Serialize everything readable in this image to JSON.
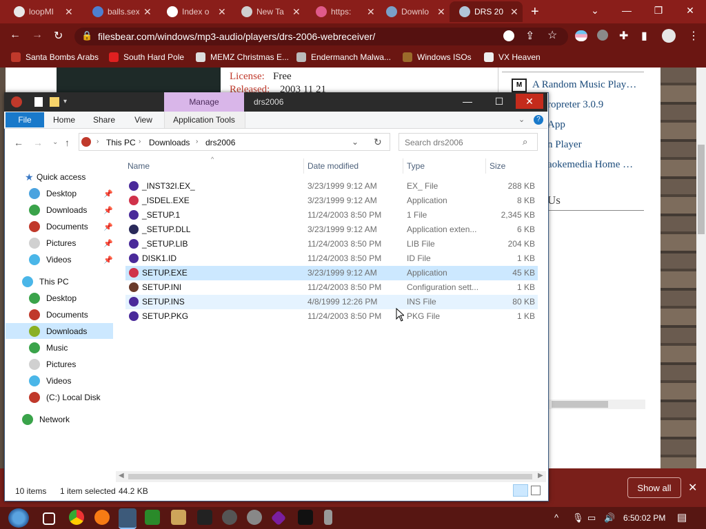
{
  "browser": {
    "tabs": [
      {
        "title": "loopMI",
        "color": "#e8e8e8"
      },
      {
        "title": "balls.sex",
        "color": "#4e7fd0"
      },
      {
        "title": "Index o",
        "color": "#ffffff"
      },
      {
        "title": "New Ta",
        "color": "#cfcfcf"
      },
      {
        "title": "https:",
        "color": "#e05a8a"
      },
      {
        "title": "Downlo",
        "color": "#7aa0c8"
      },
      {
        "title": "DRS 20",
        "color": "#b0c4d8"
      }
    ],
    "new_tab": "+",
    "url": "filesbear.com/windows/mp3-audio/players/drs-2006-webreceiver/",
    "bookmarks": [
      "Santa Bombs Arabs",
      "South Hard Pole",
      "MEMZ Christmas E...",
      "Endermanch Malwa...",
      "Windows ISOs",
      "VX Heaven"
    ]
  },
  "webpage": {
    "license_label": "License:",
    "license_value": "Free",
    "released_label": "Released:",
    "released_value": "2003 11 21",
    "side_links": [
      "A Random Music Play…",
      "ropreter 3.0.9",
      "App",
      "n Player",
      "aokemedia Home …"
    ],
    "side_heading": "Us"
  },
  "download_shelf": {
    "show_all": "Show all",
    "close": "✕"
  },
  "explorer": {
    "title": "drs2006",
    "manage": "Manage",
    "ribbon_tabs": [
      "File",
      "Home",
      "Share",
      "View",
      "Application Tools"
    ],
    "breadcrumb": [
      "This PC",
      "Downloads",
      "drs2006"
    ],
    "search_placeholder": "Search drs2006",
    "columns": {
      "name": "Name",
      "date": "Date modified",
      "type": "Type",
      "size": "Size"
    },
    "quick_access": "Quick access",
    "qa_items": [
      "Desktop",
      "Downloads",
      "Documents",
      "Pictures",
      "Videos"
    ],
    "this_pc": "This PC",
    "pc_items": [
      "Desktop",
      "Documents",
      "Downloads",
      "Music",
      "Pictures",
      "Videos",
      "(C:) Local Disk"
    ],
    "network": "Network",
    "files": [
      {
        "name": "_INST32I.EX_",
        "date": "3/23/1999 9:12 AM",
        "type": "EX_ File",
        "size": "288 KB"
      },
      {
        "name": "_ISDEL.EXE",
        "date": "3/23/1999 9:12 AM",
        "type": "Application",
        "size": "8 KB"
      },
      {
        "name": "_SETUP.1",
        "date": "11/24/2003 8:50 PM",
        "type": "1 File",
        "size": "2,345 KB"
      },
      {
        "name": "_SETUP.DLL",
        "date": "3/23/1999 9:12 AM",
        "type": "Application exten...",
        "size": "6 KB"
      },
      {
        "name": "_SETUP.LIB",
        "date": "11/24/2003 8:50 PM",
        "type": "LIB File",
        "size": "204 KB"
      },
      {
        "name": "DISK1.ID",
        "date": "11/24/2003 8:50 PM",
        "type": "ID File",
        "size": "1 KB"
      },
      {
        "name": "SETUP.EXE",
        "date": "3/23/1999 9:12 AM",
        "type": "Application",
        "size": "45 KB"
      },
      {
        "name": "SETUP.INI",
        "date": "11/24/2003 8:50 PM",
        "type": "Configuration sett...",
        "size": "1 KB"
      },
      {
        "name": "SETUP.INS",
        "date": "4/8/1999 12:26 PM",
        "type": "INS File",
        "size": "80 KB"
      },
      {
        "name": "SETUP.PKG",
        "date": "11/24/2003 8:50 PM",
        "type": "PKG File",
        "size": "1 KB"
      }
    ],
    "status_items": "10 items",
    "status_selected": "1 item selected",
    "status_size": "44.2 KB"
  },
  "taskbar": {
    "time": "6:50:02 PM"
  }
}
